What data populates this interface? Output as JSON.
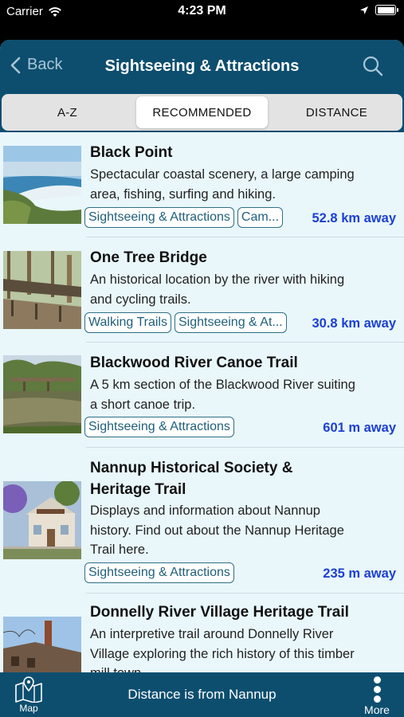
{
  "status_bar": {
    "carrier": "Carrier",
    "time": "4:23 PM"
  },
  "nav": {
    "back_label": "Back",
    "title": "Sightseeing & Attractions"
  },
  "tabs": [
    {
      "label": "A-Z"
    },
    {
      "label": "RECOMMENDED"
    },
    {
      "label": "DISTANCE"
    }
  ],
  "items": [
    {
      "title": "Black Point",
      "description": [
        "Spectacular coastal scenery, a large camping",
        "area, fishing, surfing and hiking."
      ],
      "tags": [
        "Sightseeing & Attractions",
        "Cam..."
      ],
      "distance": "52.8 km away"
    },
    {
      "title": "One Tree Bridge",
      "description": [
        "An historical location by the river with hiking",
        "and cycling trails."
      ],
      "tags": [
        "Walking Trails",
        "Sightseeing & At..."
      ],
      "distance": "30.8 km away"
    },
    {
      "title": "Blackwood River Canoe Trail",
      "description": [
        "A 5 km section of the Blackwood River suiting",
        "a short canoe trip."
      ],
      "tags": [
        "Sightseeing & Attractions"
      ],
      "distance": "601 m away"
    },
    {
      "title": [
        "Nannup Historical Society &",
        "Heritage Trail"
      ],
      "description": [
        "Displays and information about Nannup",
        "history. Find out about the Nannup Heritage",
        "Trail here."
      ],
      "tags": [
        "Sightseeing & Attractions"
      ],
      "distance": "235 m away"
    },
    {
      "title": "Donnelly River Village Heritage Trail",
      "description": [
        "An interpretive trail around Donnelly River",
        "Village exploring the rich history of this timber",
        "mill town."
      ],
      "tags": [],
      "distance": ""
    }
  ],
  "footer": {
    "map_label": "Map",
    "info_text": "Distance is from Nannup",
    "more_label": "More"
  },
  "colors": {
    "nav_bg": "#0d4e6f",
    "list_bg": "#e9f7fb",
    "tag_border": "#2f6f87",
    "distance": "#1c3fd4"
  }
}
